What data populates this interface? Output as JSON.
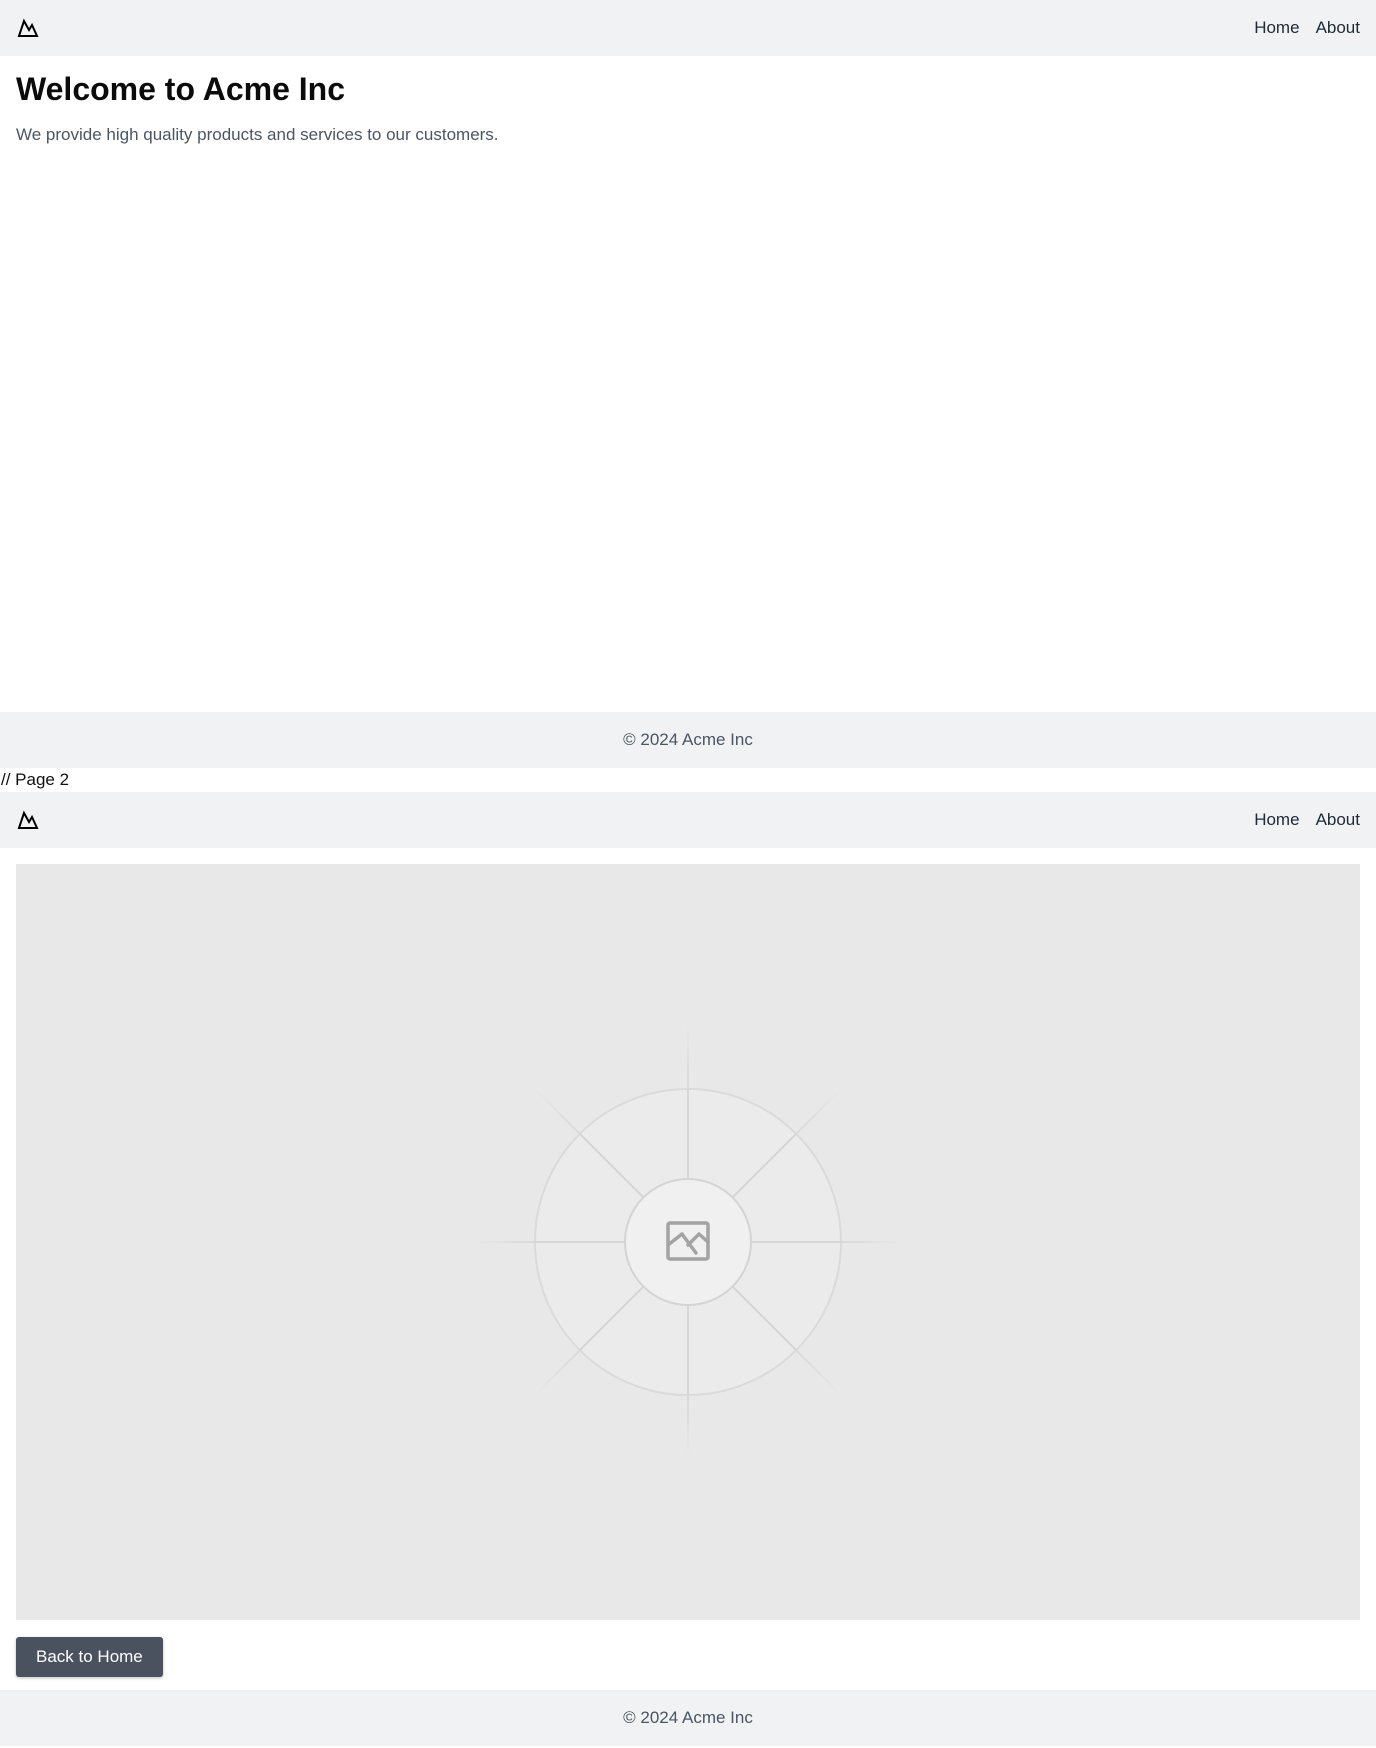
{
  "page1": {
    "nav": {
      "logo_icon": "mountain-icon",
      "links": [
        "Home",
        "About"
      ]
    },
    "hero": {
      "title": "Welcome to Acme Inc",
      "subtitle": "We provide high quality products and services to our customers."
    },
    "footer": {
      "text": "© 2024 Acme Inc"
    }
  },
  "separator": {
    "text": "// Page 2"
  },
  "page2": {
    "nav": {
      "logo_icon": "mountain-icon",
      "links": [
        "Home",
        "About"
      ]
    },
    "image": {
      "icon": "image-placeholder-icon"
    },
    "back_button_label": "Back to Home",
    "footer": {
      "text": "© 2024 Acme Inc"
    }
  },
  "colors": {
    "nav_background": "#f1f2f4",
    "button_background": "#4a5260",
    "placeholder_background": "#e8e8e8"
  }
}
